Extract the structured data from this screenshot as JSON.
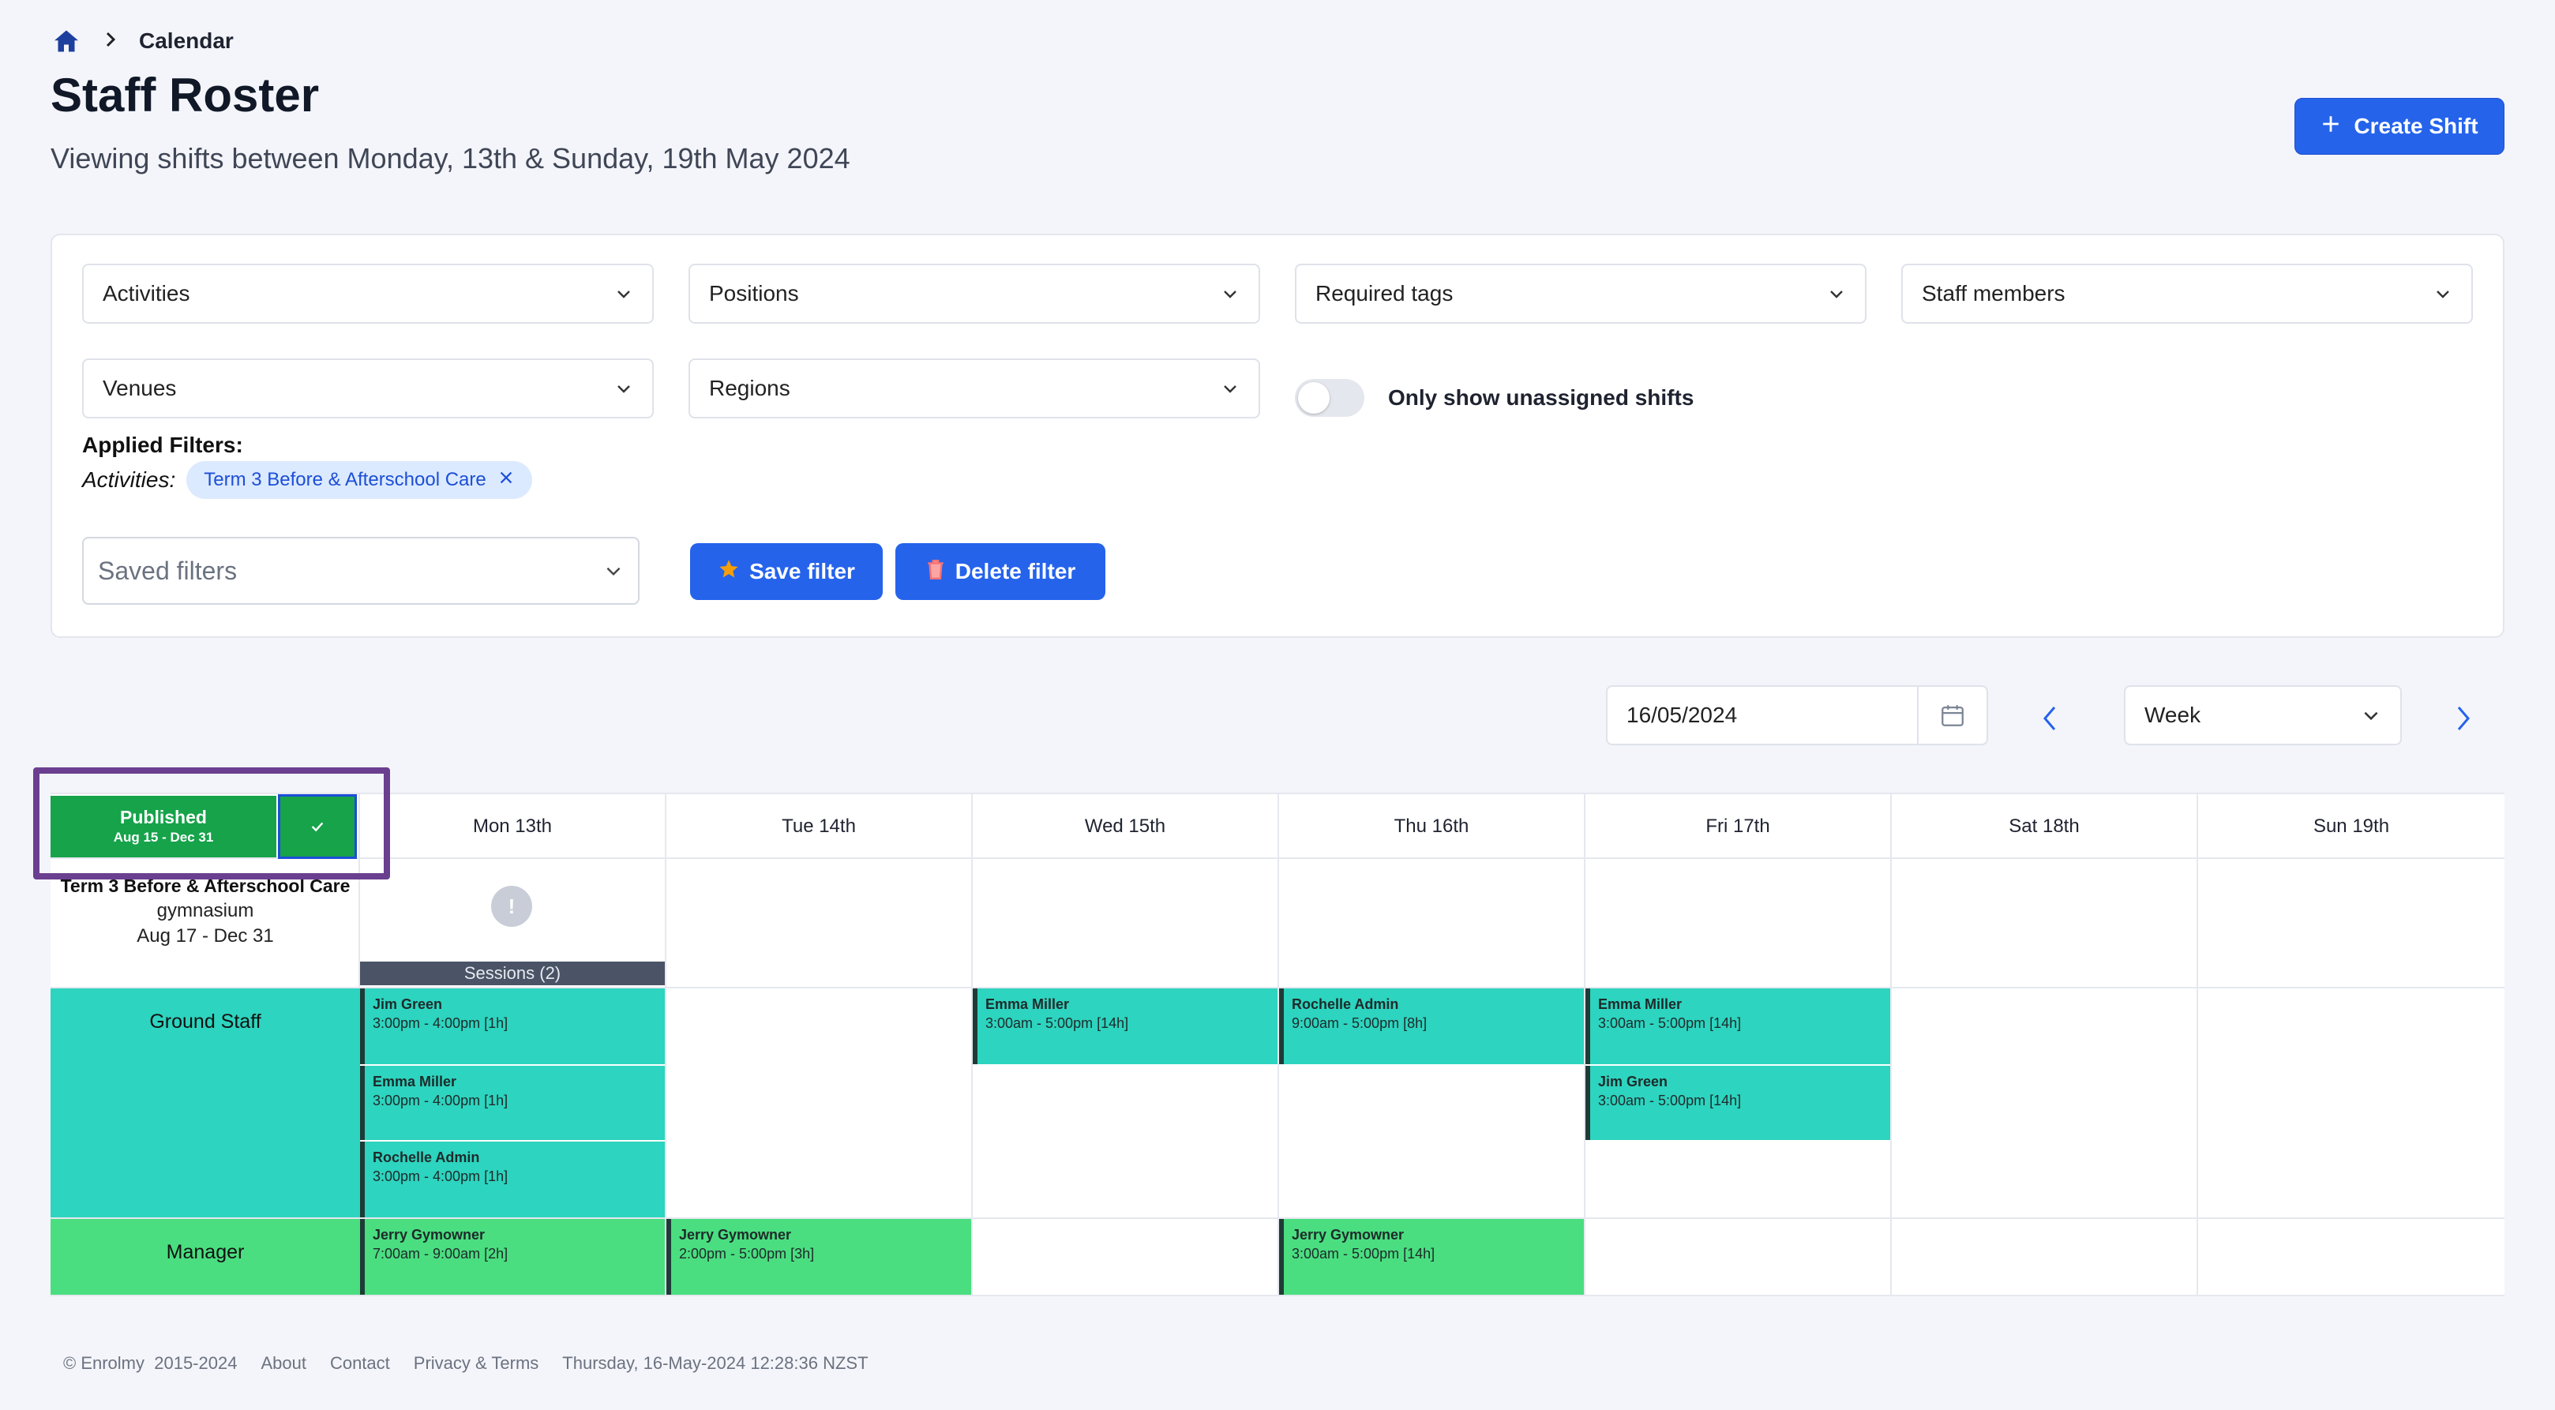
{
  "breadcrumb": {
    "current": "Calendar"
  },
  "page": {
    "title": "Staff Roster",
    "subtitle": "Viewing shifts between Monday, 13th & Sunday, 19th May 2024"
  },
  "actions": {
    "create_shift": "Create Shift"
  },
  "filters": {
    "activities": "Activities",
    "positions": "Positions",
    "required_tags": "Required tags",
    "staff_members": "Staff members",
    "venues": "Venues",
    "regions": "Regions",
    "only_unassigned": "Only show unassigned shifts",
    "only_unassigned_on": false,
    "applied_title": "Applied Filters:",
    "applied_key": "Activities:",
    "applied_chip": "Term 3 Before & Afterschool Care",
    "saved_placeholder": "Saved filters",
    "save_filter": "Save filter",
    "delete_filter": "Delete filter"
  },
  "calendar": {
    "date": "16/05/2024",
    "view": "Week",
    "publish": {
      "label": "Published",
      "range": "Aug 15 - Dec 31"
    },
    "days": [
      "Mon 13th",
      "Tue 14th",
      "Wed 15th",
      "Thu 16th",
      "Fri 17th",
      "Sat 18th",
      "Sun 19th"
    ],
    "activity": {
      "title": "Term 3 Before & Afterschool Care",
      "venue": "gymnasium",
      "dates": "Aug 17 - Dec 31",
      "warning": "!",
      "sessions": "Sessions (2)"
    },
    "roles": [
      "Ground Staff",
      "Manager"
    ],
    "shifts": {
      "gs_mon_1": {
        "name": "Jim Green",
        "time": "3:00pm - 4:00pm [1h]"
      },
      "gs_mon_2": {
        "name": "Emma Miller",
        "time": "3:00pm - 4:00pm [1h]"
      },
      "gs_mon_3": {
        "name": "Rochelle Admin",
        "time": "3:00pm - 4:00pm [1h]"
      },
      "gs_wed_1": {
        "name": "Emma Miller",
        "time": "3:00am - 5:00pm [14h]"
      },
      "gs_thu_1": {
        "name": "Rochelle Admin",
        "time": "9:00am - 5:00pm [8h]"
      },
      "gs_fri_1": {
        "name": "Emma Miller",
        "time": "3:00am - 5:00pm [14h]"
      },
      "gs_fri_2": {
        "name": "Jim Green",
        "time": "3:00am - 5:00pm [14h]"
      },
      "mg_mon_1": {
        "name": "Jerry Gymowner",
        "time": "7:00am - 9:00am [2h]"
      },
      "mg_tue_1": {
        "name": "Jerry Gymowner",
        "time": "2:00pm - 5:00pm [3h]"
      },
      "mg_thu_1": {
        "name": "Jerry Gymowner",
        "time": "3:00am - 5:00pm [14h]"
      }
    }
  },
  "colors": {
    "primary": "#2563eb",
    "published": "#16a34a",
    "ground_staff": "#2dd4bf",
    "manager": "#4ade80",
    "highlight": "#6b3f8f"
  },
  "footer": {
    "copyright": "© Enrolmy  2015-2024",
    "about": "About",
    "contact": "Contact",
    "privacy": "Privacy & Terms",
    "timestamp": "Thursday, 16-May-2024 12:28:36 NZST"
  }
}
